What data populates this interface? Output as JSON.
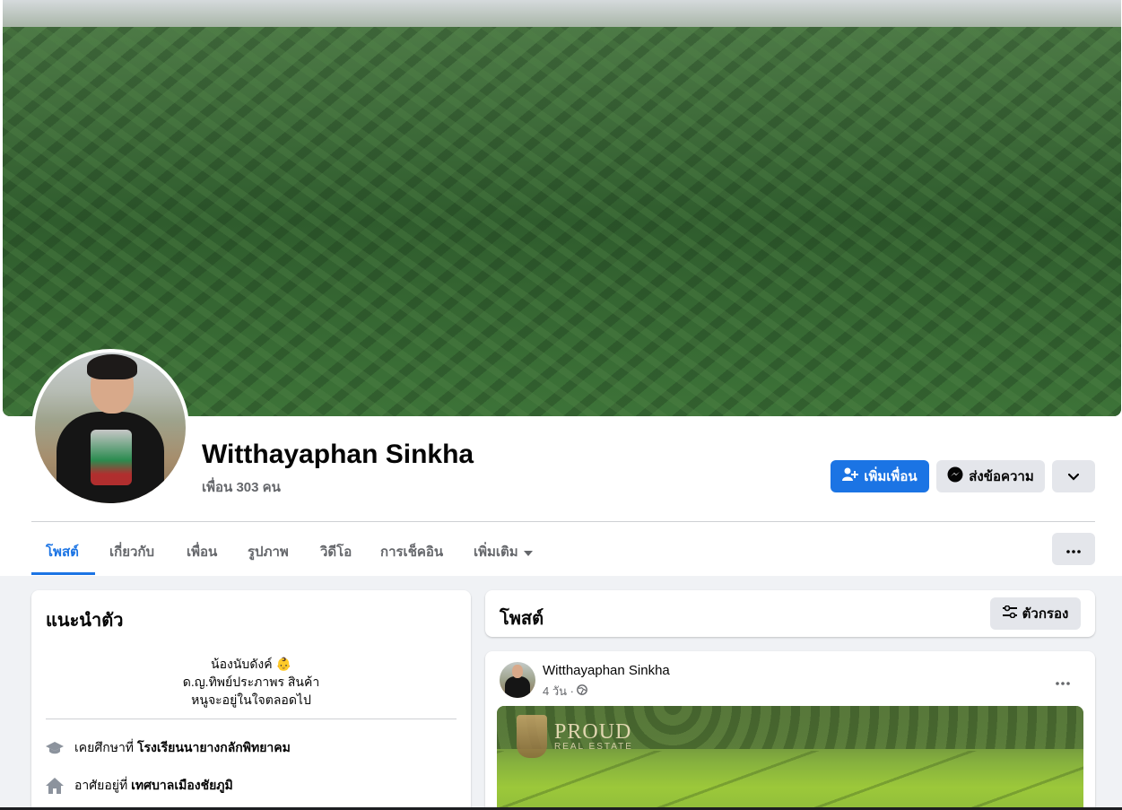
{
  "profile": {
    "name": "Witthayaphan Sinkha",
    "friends": "เพื่อน 303 คน"
  },
  "actions": {
    "add_friend": "เพิ่มเพื่อน",
    "message": "ส่งข้อความ"
  },
  "tabs": [
    {
      "label": "โพสต์"
    },
    {
      "label": "เกี่ยวกับ"
    },
    {
      "label": "เพื่อน"
    },
    {
      "label": "รูปภาพ"
    },
    {
      "label": "วิดีโอ"
    },
    {
      "label": "การเช็คอิน"
    },
    {
      "label": "เพิ่มเติม"
    }
  ],
  "intro": {
    "title": "แนะนำตัว",
    "bio": [
      "น้องนับดังค์ 👶",
      "ด.ญ.ทิพย์ประภาพร สินค้า",
      "หนูจะอยู่ในใจตลอดไป"
    ],
    "education_prefix": "เคยศึกษาที่",
    "education_place": "โรงเรียนนายางกลักพิทยาคม",
    "lives_prefix": "อาศัยอยู่ที่",
    "lives_place": "เทศบาลเมืองชัยภูมิ"
  },
  "posts": {
    "title": "โพสต์",
    "filter_label": "ตัวกรอง"
  },
  "post": {
    "author": "Witthayaphan Sinkha",
    "time": "4 วัน ·",
    "watermark_brand": "PROUD",
    "watermark_sub": "REAL ESTATE"
  },
  "colors": {
    "accent": "#1b74e4",
    "page_bg": "#f0f2f5",
    "secondary_button": "#e4e6eb",
    "muted_text": "#65676b"
  }
}
